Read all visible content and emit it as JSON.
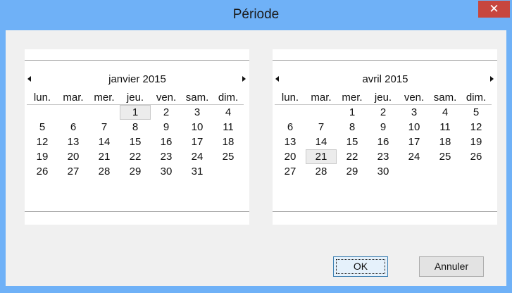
{
  "window": {
    "title": "Période",
    "close_glyph": "✕",
    "titlebar_color": "#6fb1f7",
    "close_color": "#c7463e"
  },
  "weekday_headers": [
    "lun.",
    "mar.",
    "mer.",
    "jeu.",
    "ven.",
    "sam.",
    "dim."
  ],
  "calendars": [
    {
      "month_label": "janvier 2015",
      "highlighted_day": "1",
      "weeks": [
        [
          "",
          "",
          "",
          "1",
          "2",
          "3",
          "4"
        ],
        [
          "5",
          "6",
          "7",
          "8",
          "9",
          "10",
          "11"
        ],
        [
          "12",
          "13",
          "14",
          "15",
          "16",
          "17",
          "18"
        ],
        [
          "19",
          "20",
          "21",
          "22",
          "23",
          "24",
          "25"
        ],
        [
          "26",
          "27",
          "28",
          "29",
          "30",
          "31",
          ""
        ]
      ]
    },
    {
      "month_label": "avril 2015",
      "highlighted_day": "21",
      "weeks": [
        [
          "",
          "",
          "1",
          "2",
          "3",
          "4",
          "5"
        ],
        [
          "6",
          "7",
          "8",
          "9",
          "10",
          "11",
          "12"
        ],
        [
          "13",
          "14",
          "15",
          "16",
          "17",
          "18",
          "19"
        ],
        [
          "20",
          "21",
          "22",
          "23",
          "24",
          "25",
          "26"
        ],
        [
          "27",
          "28",
          "29",
          "30",
          "",
          "",
          ""
        ]
      ]
    }
  ],
  "buttons": {
    "ok_label": "OK",
    "cancel_label": "Annuler"
  }
}
